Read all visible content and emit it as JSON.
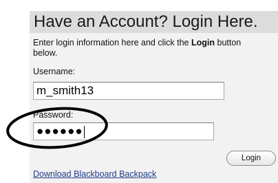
{
  "login": {
    "title": "Have an Account? Login Here.",
    "intro_text": "Enter login information here and click the ",
    "intro_bold": "Login",
    "intro_tail": " button below.",
    "username_label": "Username:",
    "username_value": "m_smith13",
    "password_label": "Password:",
    "password_masked": "●●●●●●",
    "login_button": "Login",
    "backpack_link": "Download Blackboard Backpack"
  },
  "colors": {
    "panel_background": "#f2f2f2",
    "header_background": "#dcdcdc",
    "link": "#1f3c88",
    "annotation_ellipse": "#000000"
  },
  "icons": {
    "annotation": "hand-drawn-ellipse"
  }
}
